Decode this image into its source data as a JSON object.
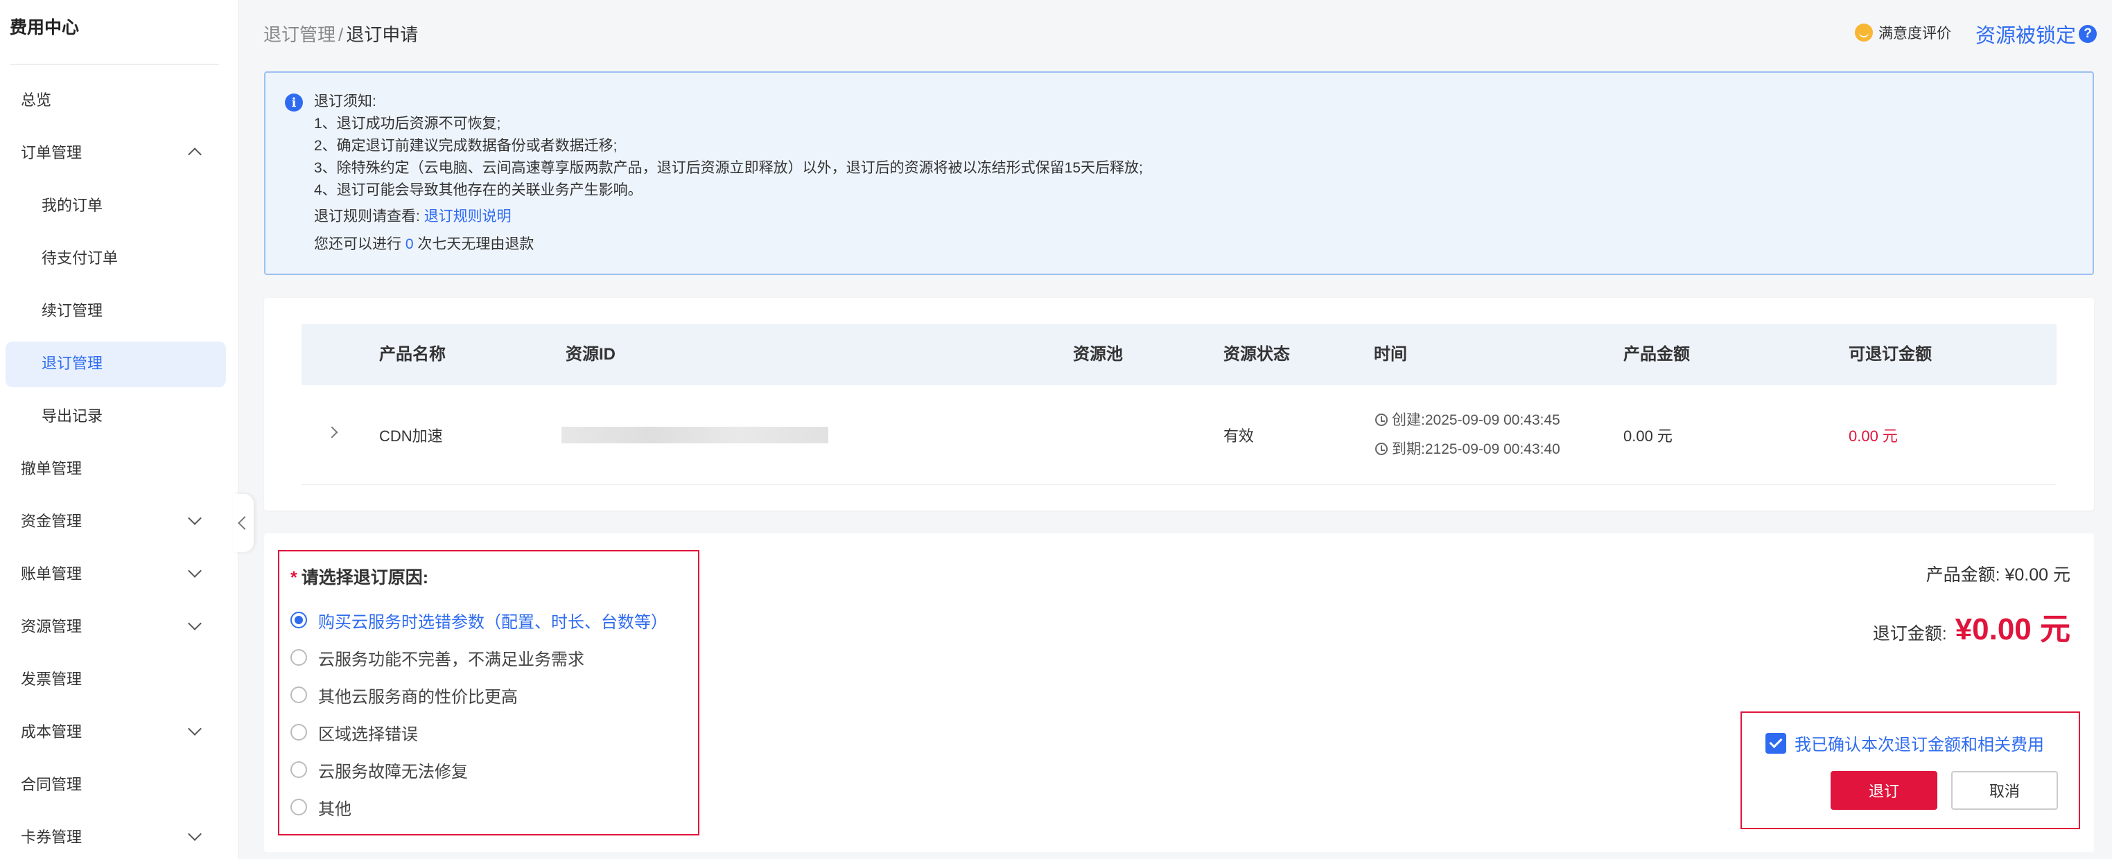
{
  "sidebar": {
    "title": "费用中心",
    "items": [
      {
        "label": "总览"
      },
      {
        "label": "订单管理"
      },
      {
        "label": "我的订单"
      },
      {
        "label": "待支付订单"
      },
      {
        "label": "续订管理"
      },
      {
        "label": "退订管理"
      },
      {
        "label": "导出记录"
      },
      {
        "label": "撤单管理"
      },
      {
        "label": "资金管理"
      },
      {
        "label": "账单管理"
      },
      {
        "label": "资源管理"
      },
      {
        "label": "发票管理"
      },
      {
        "label": "成本管理"
      },
      {
        "label": "合同管理"
      },
      {
        "label": "卡券管理"
      }
    ]
  },
  "header": {
    "breadcrumb_parent": "退订管理",
    "breadcrumb_sep": "/",
    "breadcrumb_current": "退订申请",
    "satisfaction": "满意度评价",
    "locked": "资源被锁定",
    "help": "?"
  },
  "notice": {
    "icon": "i",
    "title": "退订须知:",
    "lines": [
      "1、退订成功后资源不可恢复;",
      "2、确定退订前建议完成数据备份或者数据迁移;",
      "3、除特殊约定（云电脑、云间高速尊享版两款产品，退订后资源立即释放）以外，退订后的资源将被以冻结形式保留15天后释放;",
      "4、退订可能会导致其他存在的关联业务产生影响。"
    ],
    "rule_prefix": "退订规则请查看:",
    "rule_link": "退订规则说明",
    "refund_prefix": "您还可以进行",
    "refund_count": "0",
    "refund_suffix": "次七天无理由退款"
  },
  "table": {
    "headers": [
      "产品名称",
      "资源ID",
      "资源池",
      "资源状态",
      "时间",
      "产品金额",
      "可退订金额"
    ],
    "row": {
      "product": "CDN加速",
      "resource_id": "",
      "pool": "",
      "status": "有效",
      "created": "创建:2025-09-09 00:43:45",
      "expires": "到期:2125-09-09 00:43:40",
      "amount": "0.00 元",
      "refundable": "0.00 元"
    }
  },
  "reason": {
    "title": "请选择退订原因:",
    "required": "*",
    "options": [
      "购买云服务时选错参数（配置、时长、台数等）",
      "云服务功能不完善，不满足业务需求",
      "其他云服务商的性价比更高",
      "区域选择错误",
      "云服务故障无法修复",
      "其他"
    ],
    "selected_index": 0
  },
  "summary": {
    "product_amount": "产品金额:  ¥0.00 元",
    "refund_label": "退订金额:",
    "refund_value": "¥0.00 元"
  },
  "confirm": {
    "label": "我已确认本次退订金额和相关费用",
    "checked": true,
    "refund_button": "退订",
    "cancel_button": "取消"
  },
  "colors": {
    "accent": "#2e6bf0",
    "danger": "#e0143c"
  }
}
